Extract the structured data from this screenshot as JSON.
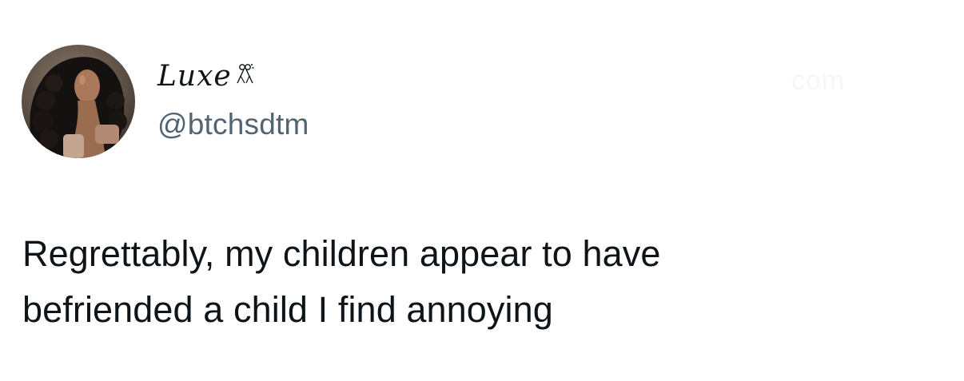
{
  "author": {
    "display_name": "Luxe",
    "handle": "@btchsdtm",
    "avatar_icon": "profile-photo-avatar",
    "name_decoration_icon": "bow-icon"
  },
  "watermark": {
    "text": "com"
  },
  "tweet": {
    "lines": [
      "Regrettably, my children appear to have",
      "befriended a child I find annoying"
    ]
  },
  "colors": {
    "text_primary": "#0f1419",
    "text_secondary": "#536471",
    "background": "#ffffff"
  }
}
